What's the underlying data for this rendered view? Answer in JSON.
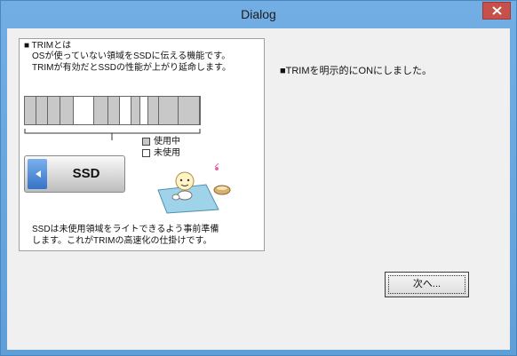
{
  "window": {
    "title": "Dialog",
    "close_label": "×"
  },
  "picture": {
    "heading": "■ TRIMとは",
    "intro_line1": "OSが使っていない領域をSSDに伝える機能です。",
    "intro_line2": "TRIMが有効だとSSDの性能が上がり延命します。",
    "blocks": [
      "used",
      "used",
      "used",
      "used",
      "free",
      "used",
      "used",
      "free",
      "used",
      "free",
      "used",
      "used",
      "used"
    ],
    "legend_used": "使用中",
    "legend_free": "未使用",
    "ssd_label": "SSD",
    "footer_line1": "SSDは未使用領域をライトできるよう事前準備",
    "footer_line2": "します。これがTRIMの高速化の仕掛けです。"
  },
  "message": "■TRIMを明示的にONにしました。",
  "buttons": {
    "next_label": "次へ..."
  },
  "colors": {
    "accent": "#6fa8dc",
    "close": "#c7504b"
  }
}
